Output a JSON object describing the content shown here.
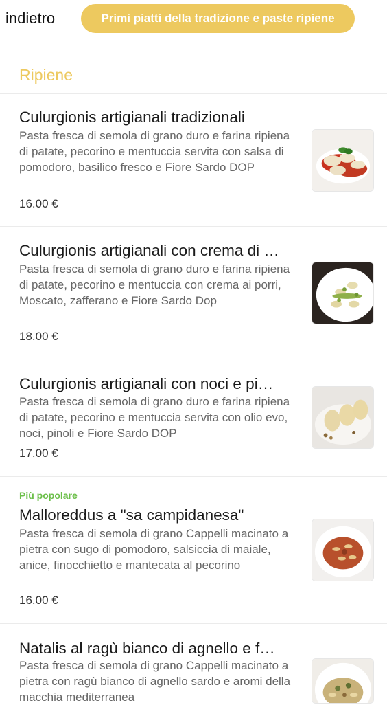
{
  "header": {
    "back_label": "indietro",
    "category_label": "Primi piatti della tradizione e paste ripiene"
  },
  "section": {
    "title": "Ripiene"
  },
  "items": [
    {
      "badge": "",
      "name": "Culurgionis artigianali tradizionali",
      "description": "Pasta fresca di semola di grano duro e farina ripiena di patate, pecorino e mentuccia servita con salsa di pomodoro, basilico fresco e Fiore Sardo DOP",
      "price": "16.00 €",
      "image_icon": "culurgionis-tomato-photo"
    },
    {
      "badge": "",
      "name": "Culurgionis artigianali con crema di …",
      "description": "Pasta fresca di semola di grano duro e farina ripiena di patate, pecorino e mentuccia con crema ai porri, Moscato, zafferano e Fiore Sardo Dop",
      "price": "18.00 €",
      "image_icon": "culurgionis-leek-photo"
    },
    {
      "badge": "",
      "name": "Culurgionis artigianali con noci e pi…",
      "description": "Pasta fresca di semola di grano duro e farina ripiena di patate, pecorino e mentuccia servita con olio evo, noci, pinoli e Fiore Sardo DOP",
      "price": "17.00 €",
      "image_icon": "culurgionis-walnut-photo"
    },
    {
      "badge": "Più popolare",
      "name": "Malloreddus a \"sa campidanesa\"",
      "description": "Pasta fresca di semola di grano Cappelli macinato a pietra con sugo di pomodoro, salsiccia di maiale, anice, finocchietto e mantecata al pecorino",
      "price": "16.00 €",
      "image_icon": "malloreddus-photo"
    },
    {
      "badge": "",
      "name": "Natalis al ragù bianco di agnello e f…",
      "description": "Pasta fresca di semola di grano Cappelli macinato a pietra con ragù bianco di agnello sardo e aromi della macchia mediterranea",
      "price": "",
      "image_icon": "natalis-photo"
    }
  ],
  "colors": {
    "accent": "#EDC95F",
    "popular": "#6CBF4A"
  }
}
